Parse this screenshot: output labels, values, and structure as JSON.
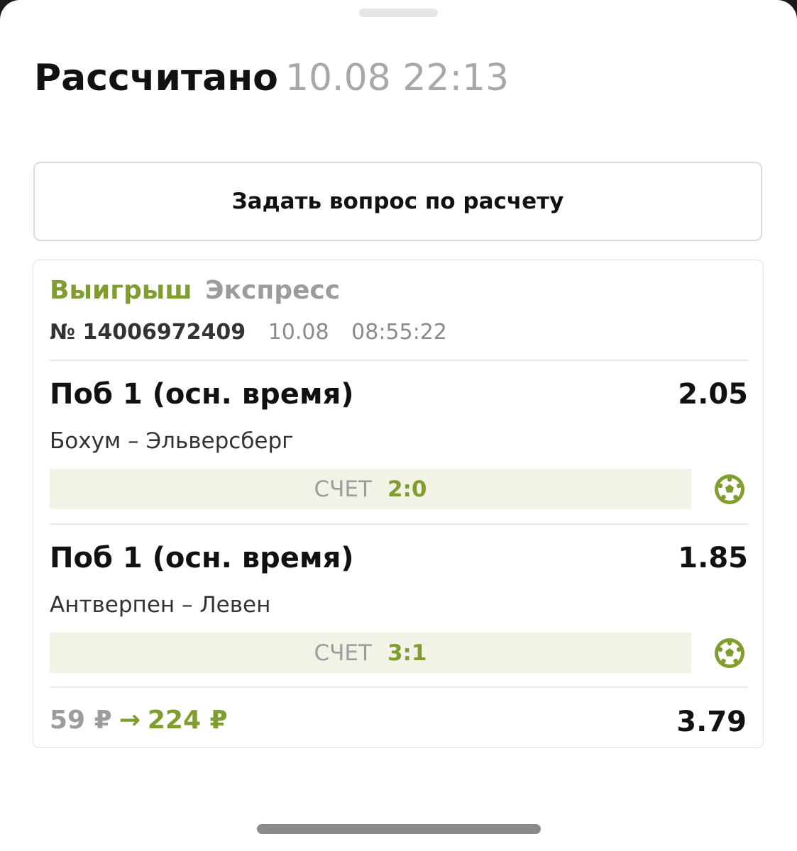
{
  "header": {
    "status": "Рассчитано",
    "timestamp": "10.08 22:13"
  },
  "ask_button_label": "Задать вопрос по расчету",
  "bet": {
    "result": "Выигрыш",
    "type": "Экспресс",
    "number": "№ 14006972409",
    "date": "10.08",
    "time": "08:55:22",
    "events": [
      {
        "market": "Поб 1 (осн. время)",
        "odds": "2.05",
        "teams": "Бохум – Эльверсберг",
        "score_label": "СЧЕТ",
        "score": "2:0",
        "sport_icon": "soccer-ball-icon"
      },
      {
        "market": "Поб 1 (осн. время)",
        "odds": "1.85",
        "teams": "Антверпен – Левен",
        "score_label": "СЧЕТ",
        "score": "3:1",
        "sport_icon": "soccer-ball-icon"
      }
    ],
    "stake": "59 ₽",
    "arrow": "→",
    "payout": "224 ₽",
    "total_odds": "3.79"
  },
  "colors": {
    "accent_green": "#7f9e2e",
    "score_bg": "#f2f3e6",
    "muted_text": "#9c9c9c"
  }
}
